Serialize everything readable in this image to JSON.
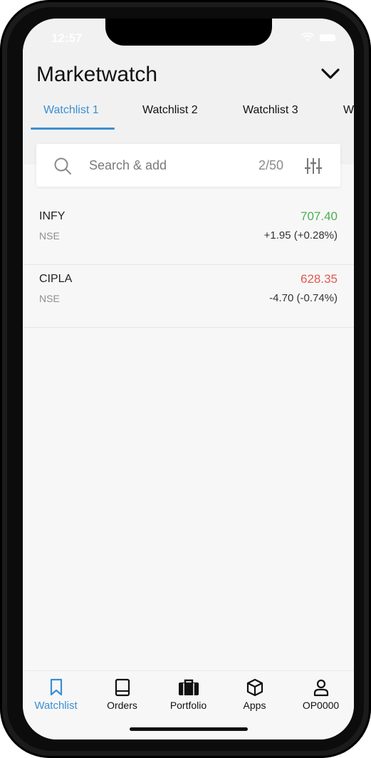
{
  "status": {
    "time": "12:57"
  },
  "header": {
    "title": "Marketwatch"
  },
  "tabs": [
    {
      "label": "Watchlist 1",
      "active": true
    },
    {
      "label": "Watchlist 2",
      "active": false
    },
    {
      "label": "Watchlist 3",
      "active": false
    },
    {
      "label": "W",
      "active": false
    }
  ],
  "search": {
    "placeholder": "Search & add",
    "count": "2/50"
  },
  "watchlist": [
    {
      "symbol": "INFY",
      "exchange": "NSE",
      "ltp": "707.40",
      "change": "+1.95 (+0.28%)",
      "direction": "up"
    },
    {
      "symbol": "CIPLA",
      "exchange": "NSE",
      "ltp": "628.35",
      "change": "-4.70 (-0.74%)",
      "direction": "down"
    }
  ],
  "bottom_nav": [
    {
      "label": "Watchlist",
      "icon": "bookmark-icon",
      "active": true
    },
    {
      "label": "Orders",
      "icon": "book-icon",
      "active": false
    },
    {
      "label": "Portfolio",
      "icon": "briefcase-icon",
      "active": false
    },
    {
      "label": "Apps",
      "icon": "cube-icon",
      "active": false
    },
    {
      "label": "OP0000",
      "icon": "user-icon",
      "active": false
    }
  ],
  "colors": {
    "accent": "#3a8fd4",
    "up": "#4caf50",
    "down": "#e05a4f"
  }
}
